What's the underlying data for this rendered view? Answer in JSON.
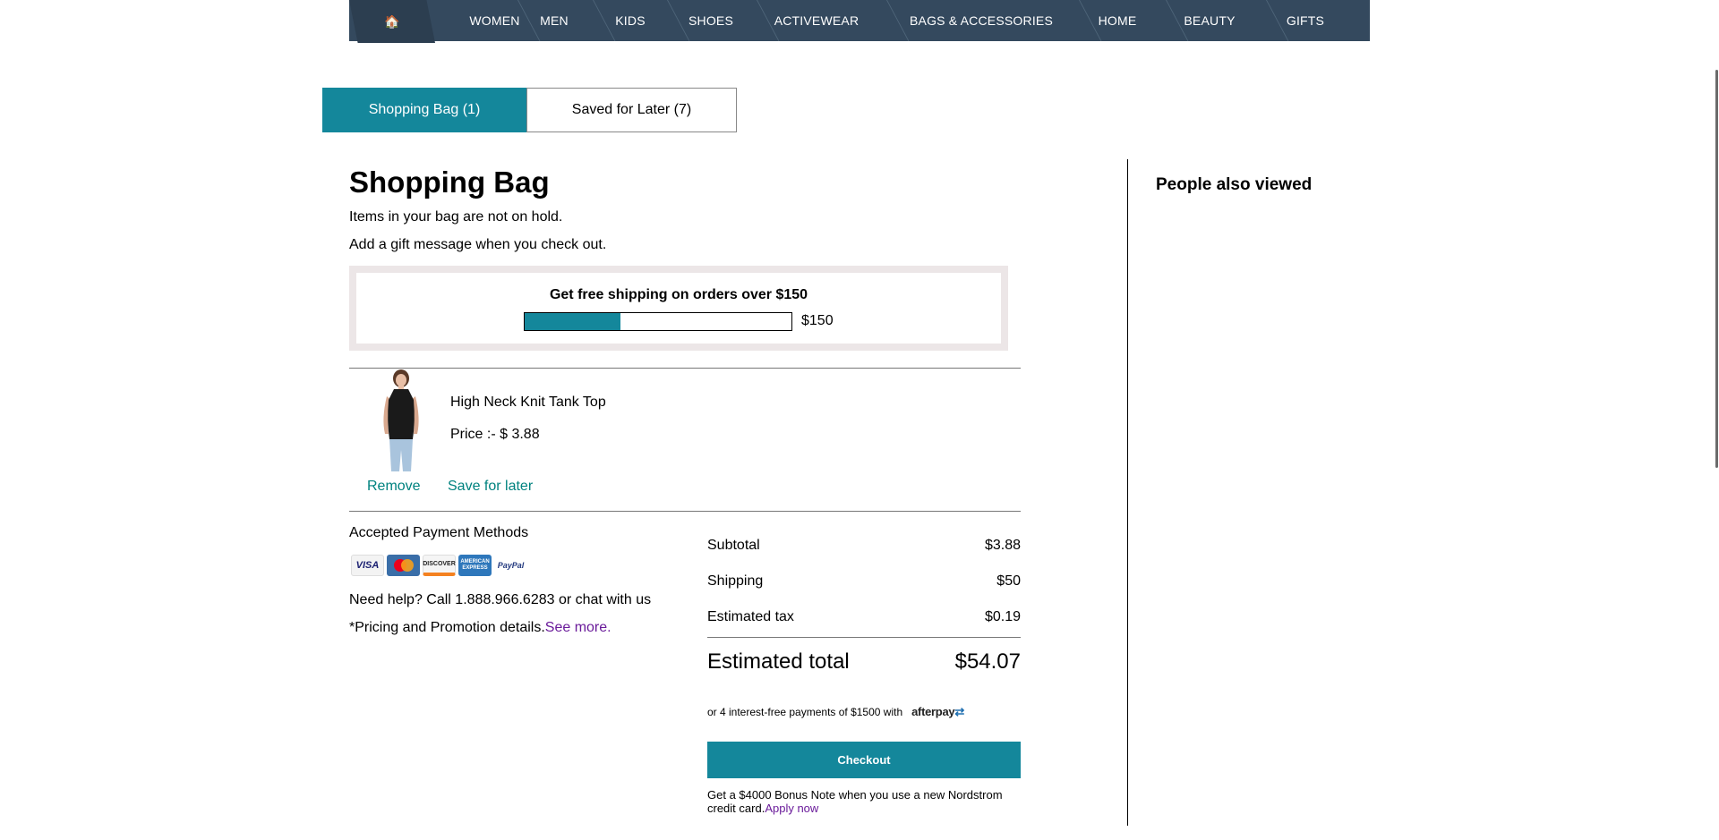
{
  "nav": {
    "items": [
      {
        "label": "WOMEN"
      },
      {
        "label": "MEN"
      },
      {
        "label": "KIDS"
      },
      {
        "label": "SHOES"
      },
      {
        "label": "ACTIVEWEAR"
      },
      {
        "label": "BAGS & ACCESSORIES"
      },
      {
        "label": "HOME"
      },
      {
        "label": "BEAUTY"
      },
      {
        "label": "GIFTS"
      }
    ],
    "home_icon": "home-icon"
  },
  "tabs": {
    "bag": "Shopping Bag (1)",
    "saved": "Saved for Later (7)"
  },
  "bag": {
    "title": "Shopping Bag",
    "note_hold": "Items in your bag are not on hold.",
    "note_gift": "Add a gift message when you check out.",
    "shipping": {
      "title": "Get free shipping on orders over $150",
      "threshold": "$150",
      "progress": 0.36
    },
    "item": {
      "name": "High Neck Knit Tank Top",
      "price": "Price :- $ 3.88",
      "remove": "Remove",
      "save_for_later": "Save for later"
    }
  },
  "payments": {
    "title": "Accepted Payment Methods",
    "cards": [
      "VISA",
      "MasterCard",
      "DISCOVER",
      "AMERICAN EXPRESS",
      "PayPal"
    ],
    "help": "Need help? Call 1.888.966.6283 or chat with us",
    "pricing": "*Pricing and Promotion details.",
    "see_more": "See more."
  },
  "summary": {
    "subtotal_label": "Subtotal",
    "subtotal": "$3.88",
    "shipping_label": "Shipping",
    "shipping": "$50",
    "tax_label": "Estimated tax",
    "tax": "$0.19",
    "total_label": "Estimated total",
    "total": "$54.07",
    "afterpay_text": "or 4 interest-free payments of $1500 with",
    "afterpay_logo": "afterpay",
    "checkout": "Checkout",
    "bonus": "Get a $4000 Bonus Note when you use a new Nordstrom credit card.",
    "apply": "Apply now"
  },
  "sidebar": {
    "title": "People also viewed"
  },
  "colors": {
    "nav": "#34495e",
    "accent": "#14879b",
    "link": "#00827f",
    "purple": "#6a1b9a"
  }
}
